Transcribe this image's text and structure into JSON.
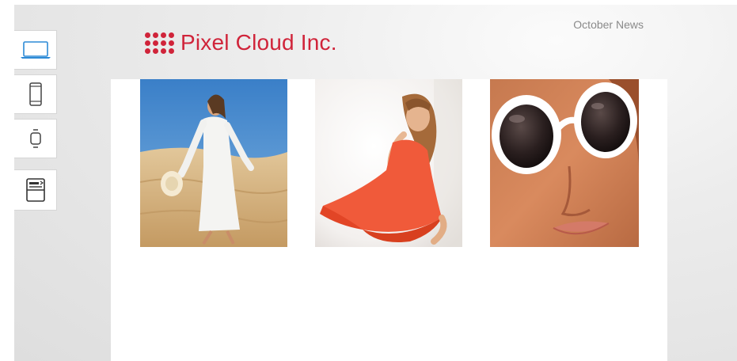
{
  "device_bar": {
    "items": [
      {
        "icon": "laptop-icon",
        "active": true
      },
      {
        "icon": "phone-icon",
        "active": false
      },
      {
        "icon": "watch-icon",
        "active": false
      },
      {
        "icon": "email-template-icon",
        "active": false
      }
    ],
    "accent_color": "#2d8ad6"
  },
  "header": {
    "brand": "Pixel Cloud Inc.",
    "meta": "October News",
    "brand_color": "#d0243a"
  },
  "gallery": {
    "images": [
      {
        "name": "woman-white-dress-desert-photo"
      },
      {
        "name": "woman-red-dress-photo"
      },
      {
        "name": "woman-white-sunglasses-photo"
      }
    ]
  }
}
